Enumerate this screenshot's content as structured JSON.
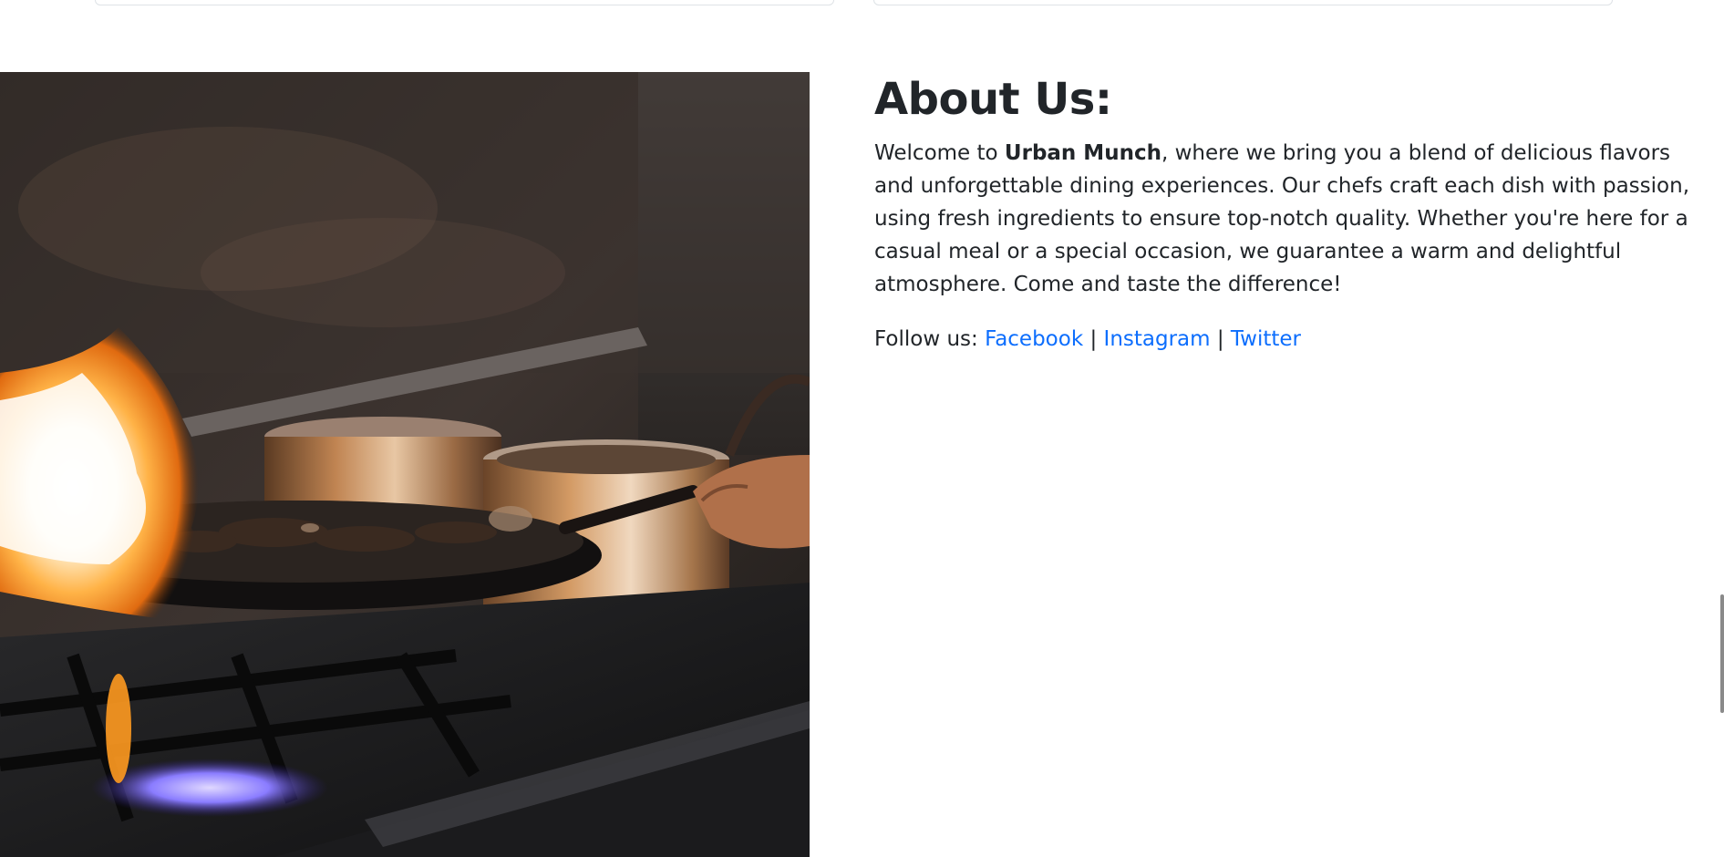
{
  "about": {
    "heading": "About Us:",
    "intro_before": "Welcome to ",
    "brand": "Urban Munch",
    "intro_after": ", where we bring you a blend of delicious flavors and unforgettable dining experiences. Our chefs craft each dish with passion, using fresh ingredients to ensure top-notch quality. Whether you're here for a casual meal or a special occasion, we guarantee a warm and delightful atmosphere. Come and taste the difference!",
    "follow_label": "Follow us:",
    "separator": "|",
    "links": [
      {
        "label": "Facebook"
      },
      {
        "label": "Instagram"
      },
      {
        "label": "Twitter"
      }
    ]
  },
  "colors": {
    "link": "#0d6efd",
    "text": "#212529",
    "border": "#dee2e6"
  },
  "image": {
    "subject": "chef cooking with flaming pan on gas stove"
  }
}
